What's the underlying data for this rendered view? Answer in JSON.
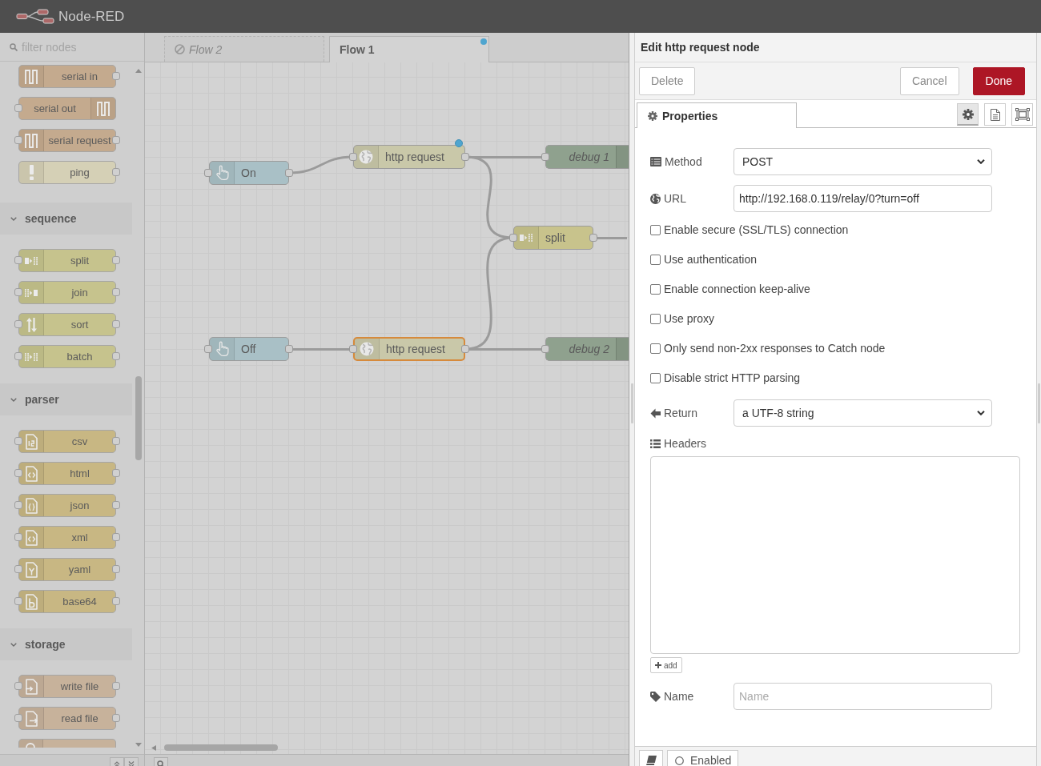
{
  "header": {
    "title": "Node-RED"
  },
  "palette": {
    "filter": {
      "placeholder": "filter nodes"
    },
    "groups": [
      {
        "nodes": [
          {
            "label": "serial in",
            "kind": "serial",
            "color": "#c4aa8e",
            "input": false,
            "output": true
          },
          {
            "label": "serial out",
            "kind": "serial",
            "color": "#c4aa8e",
            "input": true,
            "output": false
          },
          {
            "label": "serial request",
            "kind": "serial",
            "color": "#c4aa8e",
            "input": true,
            "output": true
          },
          {
            "label": "ping",
            "kind": "alert",
            "color": "#d5d0b6",
            "input": false,
            "output": true
          }
        ]
      },
      {
        "title": "sequence",
        "expanded": true,
        "nodes": [
          {
            "label": "split",
            "kind": "split",
            "color": "#c6c38d",
            "input": true,
            "output": true
          },
          {
            "label": "join",
            "kind": "join",
            "color": "#c6c38d",
            "input": true,
            "output": true
          },
          {
            "label": "sort",
            "kind": "sort",
            "color": "#c6c38d",
            "input": true,
            "output": true
          },
          {
            "label": "batch",
            "kind": "batch",
            "color": "#c6c38d",
            "input": true,
            "output": true
          }
        ]
      },
      {
        "title": "parser",
        "expanded": true,
        "nodes": [
          {
            "label": "csv",
            "kind": "csv",
            "color": "#c8b783",
            "input": true,
            "output": true
          },
          {
            "label": "html",
            "kind": "html",
            "color": "#c8b783",
            "input": true,
            "output": true
          },
          {
            "label": "json",
            "kind": "json",
            "color": "#c8b783",
            "input": true,
            "output": true
          },
          {
            "label": "xml",
            "kind": "xml",
            "color": "#c8b783",
            "input": true,
            "output": true
          },
          {
            "label": "yaml",
            "kind": "yaml",
            "color": "#c8b783",
            "input": true,
            "output": true
          },
          {
            "label": "base64",
            "kind": "base64",
            "color": "#c8b783",
            "input": true,
            "output": true
          }
        ]
      },
      {
        "title": "storage",
        "expanded": true,
        "nodes": [
          {
            "label": "write file",
            "kind": "write",
            "color": "#c7b29b",
            "input": true,
            "output": true
          },
          {
            "label": "read file",
            "kind": "read",
            "color": "#c7b29b",
            "input": true,
            "output": true
          },
          {
            "kind": "watch",
            "color": "#c7b29b"
          }
        ]
      }
    ]
  },
  "workspace": {
    "tabs": [
      {
        "label": "Flow 2",
        "selected": false,
        "disabled": true,
        "changed": false
      },
      {
        "label": "Flow 1",
        "selected": true,
        "disabled": false,
        "changed": true
      }
    ],
    "nodes": [
      {
        "label": "On",
        "kind": "inject",
        "color": "#a9c0c6",
        "selected": false,
        "changed": false
      },
      {
        "label": "http request",
        "kind": "http",
        "color": "#c9c8a9",
        "selected": false,
        "changed": true
      },
      {
        "label": "debug 1",
        "kind": "debug",
        "color": "#8fa18e",
        "selected": false,
        "changed": false
      },
      {
        "label": "split",
        "kind": "split",
        "color": "#c8c38c",
        "selected": false,
        "changed": false
      },
      {
        "label": "Off",
        "kind": "inject",
        "color": "#a9c0c6",
        "selected": false,
        "changed": false
      },
      {
        "label": "http request",
        "kind": "http",
        "color": "#c9c8a9",
        "selected": true,
        "changed": false
      },
      {
        "label": "debug 2",
        "kind": "debug",
        "color": "#8fa18e",
        "selected": false,
        "changed": false
      }
    ]
  },
  "editor": {
    "title": "Edit http request node",
    "actions": [
      {
        "label": "Delete",
        "kind": "plain"
      },
      {
        "label": "Cancel",
        "kind": "plain"
      },
      {
        "label": "Done",
        "kind": "primary"
      }
    ],
    "tabs": [
      {
        "label": "Properties",
        "selected": true
      }
    ],
    "views": [
      {
        "kind": "properties",
        "selected": true
      },
      {
        "kind": "description",
        "selected": false
      },
      {
        "kind": "appearance",
        "selected": false
      }
    ],
    "fields": [
      {
        "kind": "select",
        "label": "Method",
        "value": "POST"
      },
      {
        "kind": "text",
        "label": "URL",
        "value": "http://192.168.0.119/relay/0?turn=off"
      },
      {
        "kind": "checkbox",
        "label": "Enable secure (SSL/TLS) connection",
        "checked": false
      },
      {
        "kind": "checkbox",
        "label": "Use authentication",
        "checked": false
      },
      {
        "kind": "checkbox",
        "label": "Enable connection keep-alive",
        "checked": false
      },
      {
        "kind": "checkbox",
        "label": "Use proxy",
        "checked": false
      },
      {
        "kind": "checkbox",
        "label": "Only send non-2xx responses to Catch node",
        "checked": false
      },
      {
        "kind": "checkbox",
        "label": "Disable strict HTTP parsing",
        "checked": false
      },
      {
        "kind": "select",
        "label": "Return",
        "value": "a UTF-8 string"
      },
      {
        "kind": "list",
        "label": "Headers",
        "add_label": "add"
      },
      {
        "kind": "text",
        "label": "Name",
        "placeholder": "Name"
      }
    ],
    "footer": {
      "toggle": {
        "label": "Enabled",
        "on": true
      }
    }
  }
}
